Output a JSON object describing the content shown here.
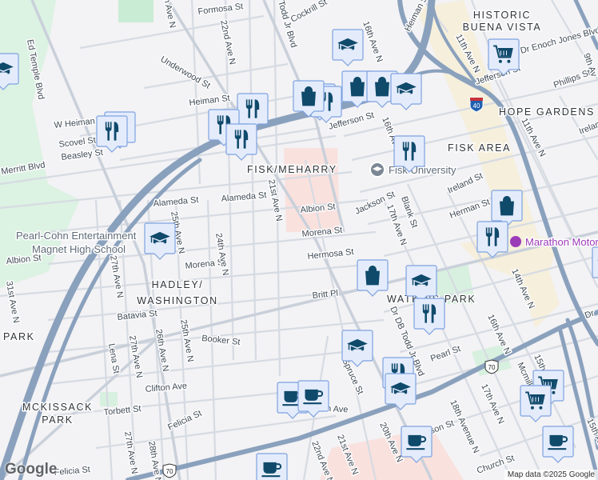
{
  "streets": [
    "Formosa St",
    "Cockrill St",
    "Todd Jr Blvd",
    "22nd Ave N",
    "h Ave N",
    "Underwood St",
    "Heiman St",
    "W Heiman St",
    "Scovel St",
    "Beasley St",
    "Merritt Blvd",
    "Ed Temple Blvd",
    "Alameda St",
    "Alameda St",
    "21st Ave N",
    "Albion St",
    "Morena St",
    "Hermosa St",
    "Britt Pl",
    "Albion St",
    "Morena St",
    "25th Ave N",
    "24th Ave N",
    "27th Ave N",
    "31st Ave N",
    "Batavia St",
    "Booker St",
    "Lena St",
    "27th Ave N",
    "26th Ave N",
    "25th Ave N",
    "Clifton Ave",
    "Torbett St",
    "Felicia St",
    "27th Ave N",
    "28th Ave N",
    "Felicia St",
    "11th Ave N",
    "Dr Enoch Jones Blvd",
    "Jefferson St",
    "Phillips St",
    "11th Ave N",
    "Jefferson St",
    "16th Ave N",
    "16th Ave N",
    "Heiman St",
    "Ireland St",
    "Jackson St",
    "Blank St",
    "17th Ave N",
    "Herman St",
    "Dr DB Todd Jr Blvd",
    "Pearl St",
    "Spruce St",
    "18th Avenue N",
    "17th Ave N",
    "16th Ave N",
    "14th Ave N",
    "Church St",
    "20th Ave N",
    "21st Ave N",
    "22nd Ave N",
    "Jackson St",
    "n Ave",
    "15th Ave N",
    "Mcmillan St",
    "15th Av",
    "Dr",
    "Ireland",
    "9th Av"
  ],
  "neighborhoods": {
    "fisk_meharry": "FISK/MEHARRY",
    "hadley_1": "HADLEY/",
    "hadley_2": "WASHINGTON",
    "park": "PARK",
    "mckissack_1": "MCKISSACK",
    "mckissack_2": "PARK",
    "buena_1": "HISTORIC",
    "buena_2": "BUENA VISTA",
    "hope": "HOPE GARDENS",
    "fisk_area": "FISK AREA",
    "watkins": "WATKINS PARK"
  },
  "pois": {
    "pearl_cohn_1": "Pearl-Cohn Entertainment",
    "pearl_cohn_2": "Magnet High School",
    "fisk_university": "Fisk University",
    "marathon": "Marathon Motor Works"
  },
  "shields": {
    "i40": "40",
    "us70_a": "70",
    "us70_b": "70"
  },
  "markers": [
    "school",
    "food",
    "food",
    "food",
    "food",
    "food",
    "school",
    "food",
    "food",
    "shopping",
    "shopping",
    "shopping",
    "school",
    "cart",
    "food",
    "school",
    "shopping",
    "food",
    "shopping",
    "school",
    "food",
    "school",
    "food",
    "school",
    "coffee",
    "coffee",
    "cart",
    "cart",
    "coffee",
    "coffee",
    "coffee",
    "school"
  ],
  "attribution": "Map data ©2025 Google",
  "logo": "Google",
  "colors": {
    "marker_bg": "#e4ecfc",
    "marker_border": "#7ea2e0",
    "icon": "#0f4a6b",
    "highway": "#8aa1bd"
  }
}
